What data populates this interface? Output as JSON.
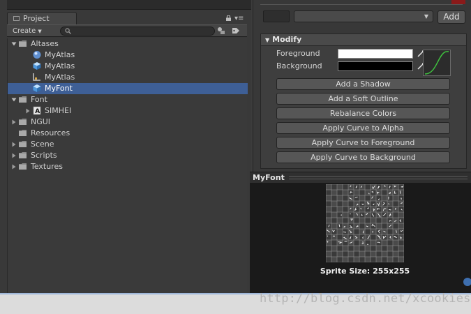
{
  "project": {
    "tab_label": "Project",
    "create_label": "Create",
    "search_placeholder": "",
    "tree": [
      {
        "label": "Altases",
        "depth": 0,
        "arrow": "down",
        "icon": "folder",
        "selected": false
      },
      {
        "label": "MyAtlas",
        "depth": 1,
        "arrow": "none",
        "icon": "material",
        "selected": false
      },
      {
        "label": "MyAtlas",
        "depth": 1,
        "arrow": "none",
        "icon": "cube",
        "selected": false
      },
      {
        "label": "MyAtlas",
        "depth": 1,
        "arrow": "none",
        "icon": "texture",
        "selected": false
      },
      {
        "label": "MyFont",
        "depth": 1,
        "arrow": "none",
        "icon": "cube",
        "selected": true
      },
      {
        "label": "Font",
        "depth": 0,
        "arrow": "down",
        "icon": "folder",
        "selected": false
      },
      {
        "label": "SIMHEI",
        "depth": 1,
        "arrow": "right",
        "icon": "font",
        "selected": false
      },
      {
        "label": "NGUI",
        "depth": 0,
        "arrow": "right",
        "icon": "folder",
        "selected": false
      },
      {
        "label": "Resources",
        "depth": 0,
        "arrow": "none",
        "icon": "folder",
        "selected": false
      },
      {
        "label": "Scene",
        "depth": 0,
        "arrow": "right",
        "icon": "folder",
        "selected": false
      },
      {
        "label": "Scripts",
        "depth": 0,
        "arrow": "right",
        "icon": "folder",
        "selected": false
      },
      {
        "label": "Textures",
        "depth": 0,
        "arrow": "right",
        "icon": "folder",
        "selected": false
      }
    ]
  },
  "inspector": {
    "add_label": "Add",
    "modify": {
      "header": "Modify",
      "foreground_label": "Foreground",
      "background_label": "Background",
      "foreground_color": "#ffffff",
      "background_color": "#000000",
      "buttons": [
        "Add a Shadow",
        "Add a Soft Outline",
        "Rebalance Colors",
        "Apply Curve to Alpha",
        "Apply Curve to Foreground",
        "Apply Curve to Background"
      ]
    }
  },
  "preview": {
    "title": "MyFont",
    "sprite_size": "Sprite Size: 255x255"
  },
  "watermark": "http://blog.csdn.net/xcookies",
  "colors": {
    "selection": "#3e5f96",
    "curve": "#3fc23f"
  }
}
